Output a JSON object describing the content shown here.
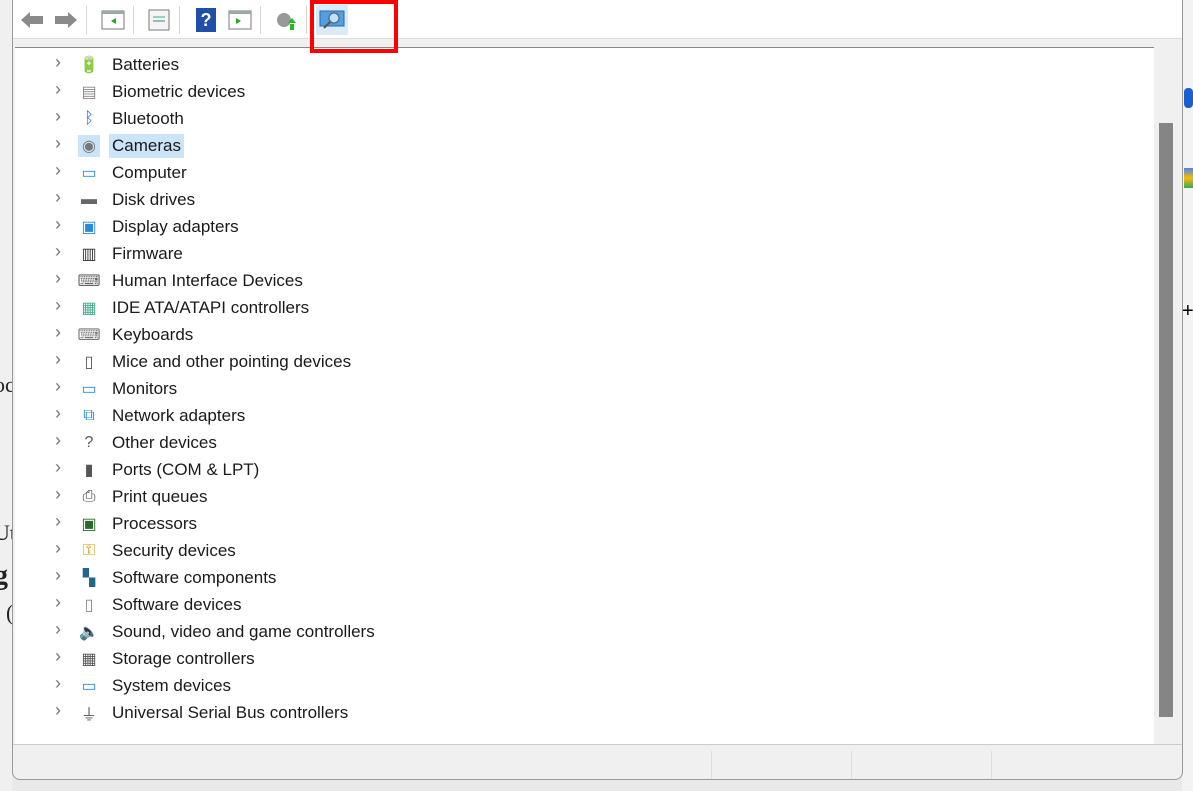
{
  "toolbar": {
    "buttons": [
      {
        "name": "back-button",
        "icon": "arrow-left-icon"
      },
      {
        "name": "forward-button",
        "icon": "arrow-right-icon"
      },
      {
        "name": "show-hide-console-tree-button",
        "icon": "console-tree-icon"
      },
      {
        "name": "properties-button",
        "icon": "properties-icon"
      },
      {
        "name": "help-button",
        "icon": "help-icon"
      },
      {
        "name": "show-action-pane-button",
        "icon": "action-pane-icon"
      },
      {
        "name": "update-driver-button",
        "icon": "update-driver-icon"
      },
      {
        "name": "scan-for-hardware-changes-button",
        "icon": "monitor-search-icon",
        "highlighted": true
      }
    ],
    "help_glyph": "?"
  },
  "tree": {
    "selected": "Cameras",
    "items": [
      {
        "label": "Batteries",
        "icon": "battery-icon"
      },
      {
        "label": "Biometric devices",
        "icon": "fingerprint-icon"
      },
      {
        "label": "Bluetooth",
        "icon": "bluetooth-icon"
      },
      {
        "label": "Cameras",
        "icon": "camera-icon"
      },
      {
        "label": "Computer",
        "icon": "computer-icon"
      },
      {
        "label": "Disk drives",
        "icon": "disk-drive-icon"
      },
      {
        "label": "Display adapters",
        "icon": "display-adapter-icon"
      },
      {
        "label": "Firmware",
        "icon": "firmware-chip-icon"
      },
      {
        "label": "Human Interface Devices",
        "icon": "hid-icon"
      },
      {
        "label": "IDE ATA/ATAPI controllers",
        "icon": "ide-controller-icon"
      },
      {
        "label": "Keyboards",
        "icon": "keyboard-icon"
      },
      {
        "label": "Mice and other pointing devices",
        "icon": "mouse-icon"
      },
      {
        "label": "Monitors",
        "icon": "monitor-icon"
      },
      {
        "label": "Network adapters",
        "icon": "network-adapter-icon"
      },
      {
        "label": "Other devices",
        "icon": "unknown-device-icon"
      },
      {
        "label": "Ports (COM & LPT)",
        "icon": "port-icon"
      },
      {
        "label": "Print queues",
        "icon": "printer-icon"
      },
      {
        "label": "Processors",
        "icon": "processor-icon"
      },
      {
        "label": "Security devices",
        "icon": "security-key-icon"
      },
      {
        "label": "Software components",
        "icon": "software-component-icon"
      },
      {
        "label": "Software devices",
        "icon": "software-device-icon"
      },
      {
        "label": "Sound, video and game controllers",
        "icon": "speaker-icon"
      },
      {
        "label": "Storage controllers",
        "icon": "storage-controller-icon"
      },
      {
        "label": "System devices",
        "icon": "system-device-icon"
      },
      {
        "label": "Universal Serial Bus controllers",
        "icon": "usb-icon"
      }
    ]
  },
  "background": {
    "fragments": [
      "oc",
      "Ut",
      "g",
      "("
    ]
  }
}
